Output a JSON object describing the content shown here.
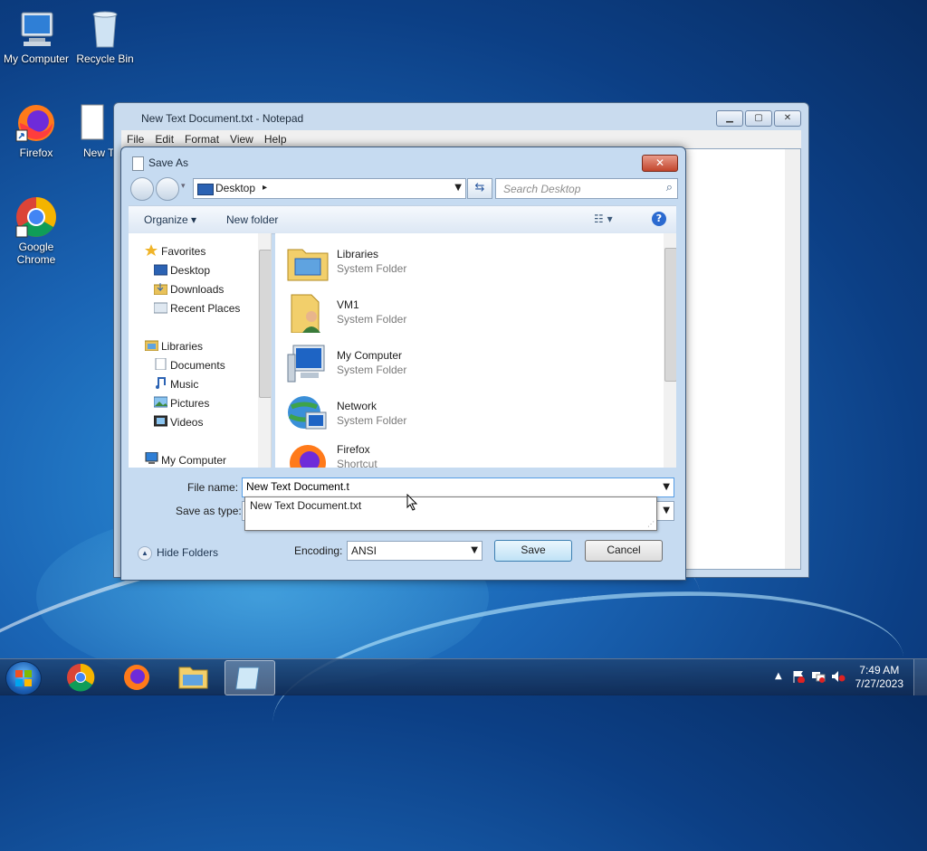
{
  "desktop": {
    "icons": [
      {
        "label": "My Computer"
      },
      {
        "label": "Recycle Bin"
      },
      {
        "label": "Firefox"
      },
      {
        "label": "New Text Document"
      },
      {
        "label": "Google Chrome"
      }
    ]
  },
  "notepad": {
    "title": "New Text Document.txt - Notepad",
    "menu": [
      "File",
      "Edit",
      "Format",
      "View",
      "Help"
    ]
  },
  "saveas": {
    "title": "Save As",
    "close_label": "✕",
    "address": "Desktop",
    "search_placeholder": "Search Desktop",
    "toolbar": {
      "organize": "Organize ▾",
      "new_folder": "New folder"
    },
    "nav": {
      "favorites": "Favorites",
      "desktop": "Desktop",
      "downloads": "Downloads",
      "recent": "Recent Places",
      "libraries": "Libraries",
      "documents": "Documents",
      "music": "Music",
      "pictures": "Pictures",
      "videos": "Videos",
      "computer": "My Computer"
    },
    "files": [
      {
        "name": "Libraries",
        "type": "System Folder"
      },
      {
        "name": "VM1",
        "type": "System Folder"
      },
      {
        "name": "My Computer",
        "type": "System Folder"
      },
      {
        "name": "Network",
        "type": "System Folder"
      },
      {
        "name": "Firefox",
        "type": "Shortcut"
      }
    ],
    "file_name_label": "File name:",
    "file_name_value": "New Text Document.t",
    "save_as_type_label": "Save as type:",
    "autocomplete_option": "New Text Document.txt",
    "hide_folders": "Hide Folders",
    "encoding_label": "Encoding:",
    "encoding_value": "ANSI",
    "save_button": "Save",
    "cancel_button": "Cancel"
  },
  "taskbar": {
    "time": "7:49 AM",
    "date": "7/27/2023"
  }
}
